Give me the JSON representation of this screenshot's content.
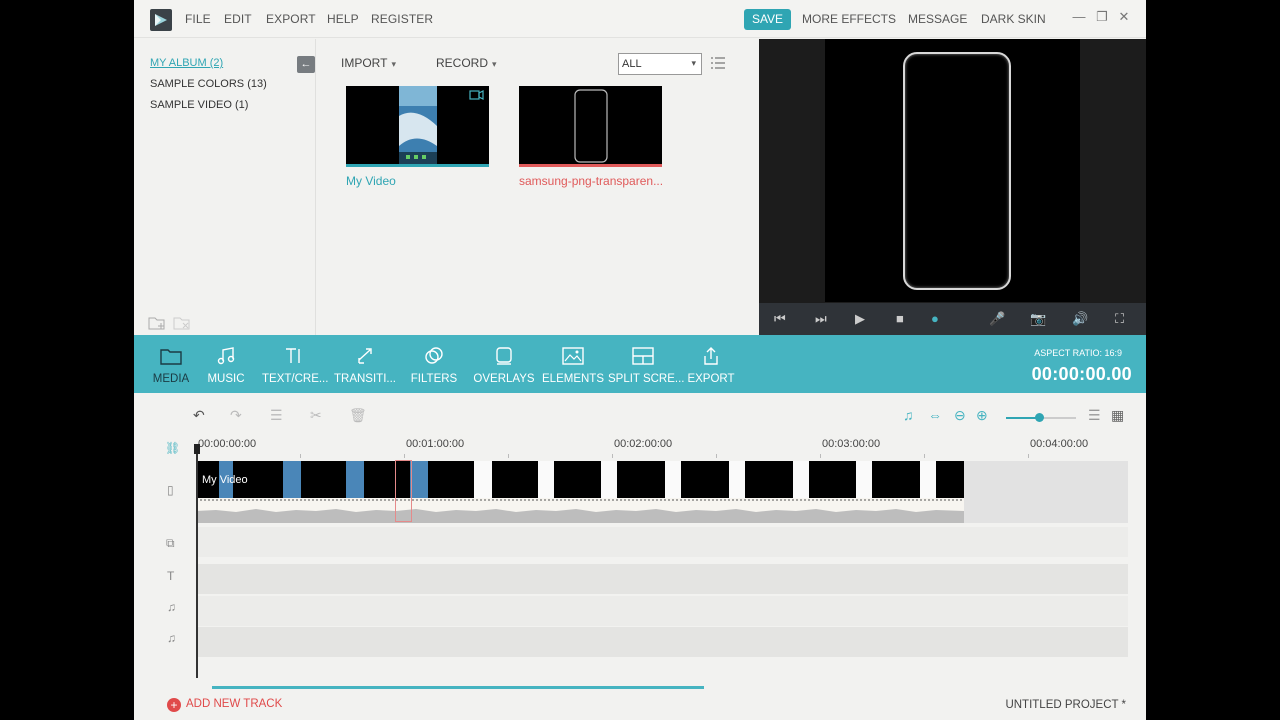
{
  "menu": [
    "FILE",
    "EDIT",
    "EXPORT",
    "HELP",
    "REGISTER"
  ],
  "top_actions": {
    "save": "SAVE",
    "more_effects": "MORE EFFECTS",
    "message": "MESSAGE",
    "dark_skin": "DARK SKIN"
  },
  "window_controls": {
    "minimize": "—",
    "maximize": "❐",
    "close": "✕"
  },
  "albums": [
    {
      "label": "MY ALBUM (2)",
      "active": true
    },
    {
      "label": "SAMPLE COLORS (13)",
      "active": false
    },
    {
      "label": "SAMPLE VIDEO (1)",
      "active": false
    }
  ],
  "library": {
    "import": "IMPORT",
    "record": "RECORD",
    "filter": "ALL",
    "items": [
      {
        "label": "My Video",
        "label_color": "#2fa5b3",
        "bar_color": "#2fa5b3"
      },
      {
        "label": "samsung-png-transparen...",
        "label_color": "#e05a5a",
        "bar_color": "#e05a5a"
      }
    ]
  },
  "toolbar": {
    "tools": [
      {
        "label": "MEDIA",
        "icon": "folder-icon"
      },
      {
        "label": "MUSIC",
        "icon": "music-icon"
      },
      {
        "label": "TEXT/CRE...",
        "icon": "text-icon"
      },
      {
        "label": "TRANSITI...",
        "icon": "transition-icon"
      },
      {
        "label": "FILTERS",
        "icon": "filter-icon"
      },
      {
        "label": "OVERLAYS",
        "icon": "overlay-icon"
      },
      {
        "label": "ELEMENTS",
        "icon": "image-icon"
      },
      {
        "label": "SPLIT SCRE...",
        "icon": "split-screen-icon"
      },
      {
        "label": "EXPORT",
        "icon": "export-icon"
      }
    ],
    "aspect_ratio": "ASPECT RATIO: 16:9",
    "timecode": "00:00:00.00"
  },
  "timeline": {
    "ruler": [
      "00:00:00:00",
      "00:01:00:00",
      "00:02:00:00",
      "00:03:00:00",
      "00:04:00:00"
    ],
    "clip_name": "My Video",
    "zoom_level": 0.45
  },
  "footer": {
    "add_track": "ADD NEW TRACK",
    "project": "UNTITLED PROJECT *"
  },
  "colors": {
    "accent": "#2fa5b3",
    "toolbar": "#46b4c1",
    "danger": "#e04a4a"
  }
}
